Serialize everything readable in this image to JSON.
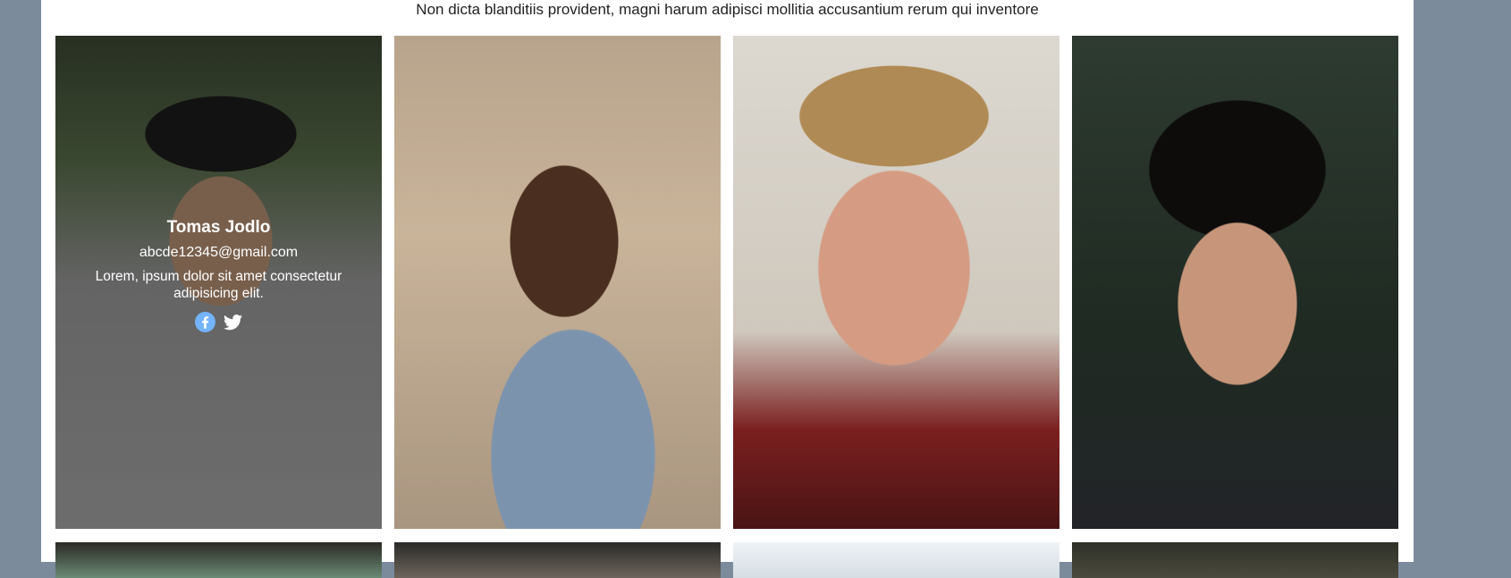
{
  "subtitle": "Non dicta blanditiis provident, magni harum adipisci mollitia accusantium rerum qui inventore",
  "featured_card": {
    "name": "Tomas Jodlo",
    "email": "abcde12345@gmail.com",
    "bio": "Lorem, ipsum dolor sit amet consectetur adipisicing elit.",
    "social": [
      {
        "icon": "facebook-icon",
        "color": "#74b3ff"
      },
      {
        "icon": "twitter-icon",
        "color": "#ffffff"
      }
    ]
  },
  "colors": {
    "page_background": "#7b8b9c",
    "content_background": "#ffffff"
  }
}
